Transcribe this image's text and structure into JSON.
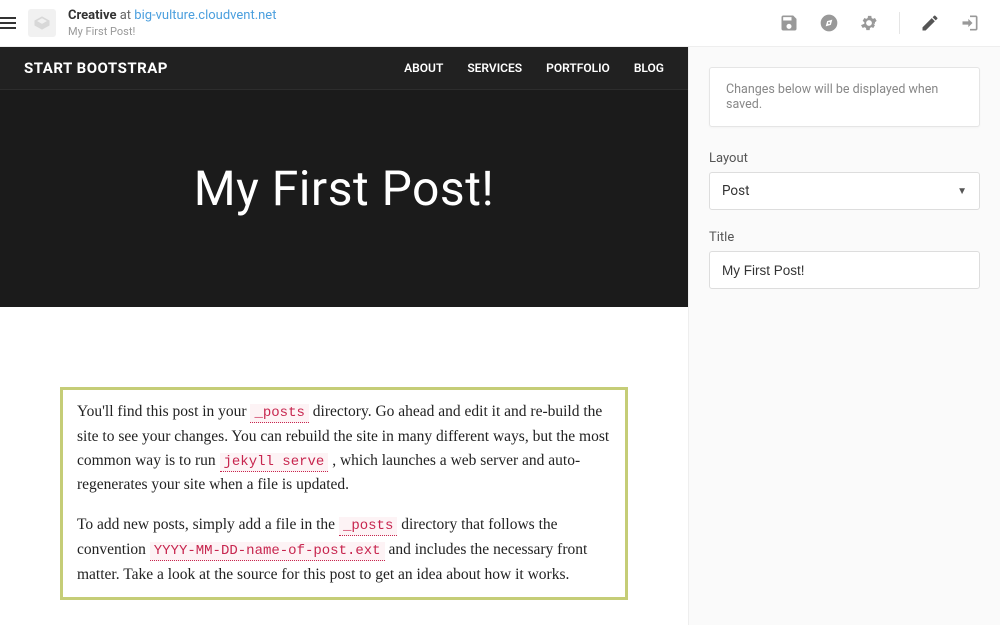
{
  "topbar": {
    "site_name": "Creative",
    "at": "at",
    "site_url": "big-vulture.cloudvent.net",
    "subtitle": "My First Post!"
  },
  "preview": {
    "brand": "START BOOTSTRAP",
    "nav": {
      "about": "ABOUT",
      "services": "SERVICES",
      "portfolio": "PORTFOLIO",
      "blog": "BLOG"
    },
    "hero_title": "My First Post!",
    "post": {
      "p1_a": "You'll find this post in your ",
      "code1": "_posts",
      "p1_b": " directory. Go ahead and edit it and re-build the site to see your changes. You can rebuild the site in many different ways, but the most common way is to run ",
      "code2": "jekyll serve",
      "p1_c": " , which launches a web server and auto-regenerates your site when a file is updated.",
      "p2_a": "To add new posts, simply add a file in the ",
      "code3": "_posts",
      "p2_b": " directory that follows the convention ",
      "code4": "YYYY-MM-DD-name-of-post.ext",
      "p2_c": " and includes the necessary front matter. Take a look at the source for this post to get an idea about how it works."
    }
  },
  "sidebar": {
    "notice": "Changes below will be displayed when saved.",
    "layout_label": "Layout",
    "layout_value": "Post",
    "title_label": "Title",
    "title_value": "My First Post!"
  }
}
